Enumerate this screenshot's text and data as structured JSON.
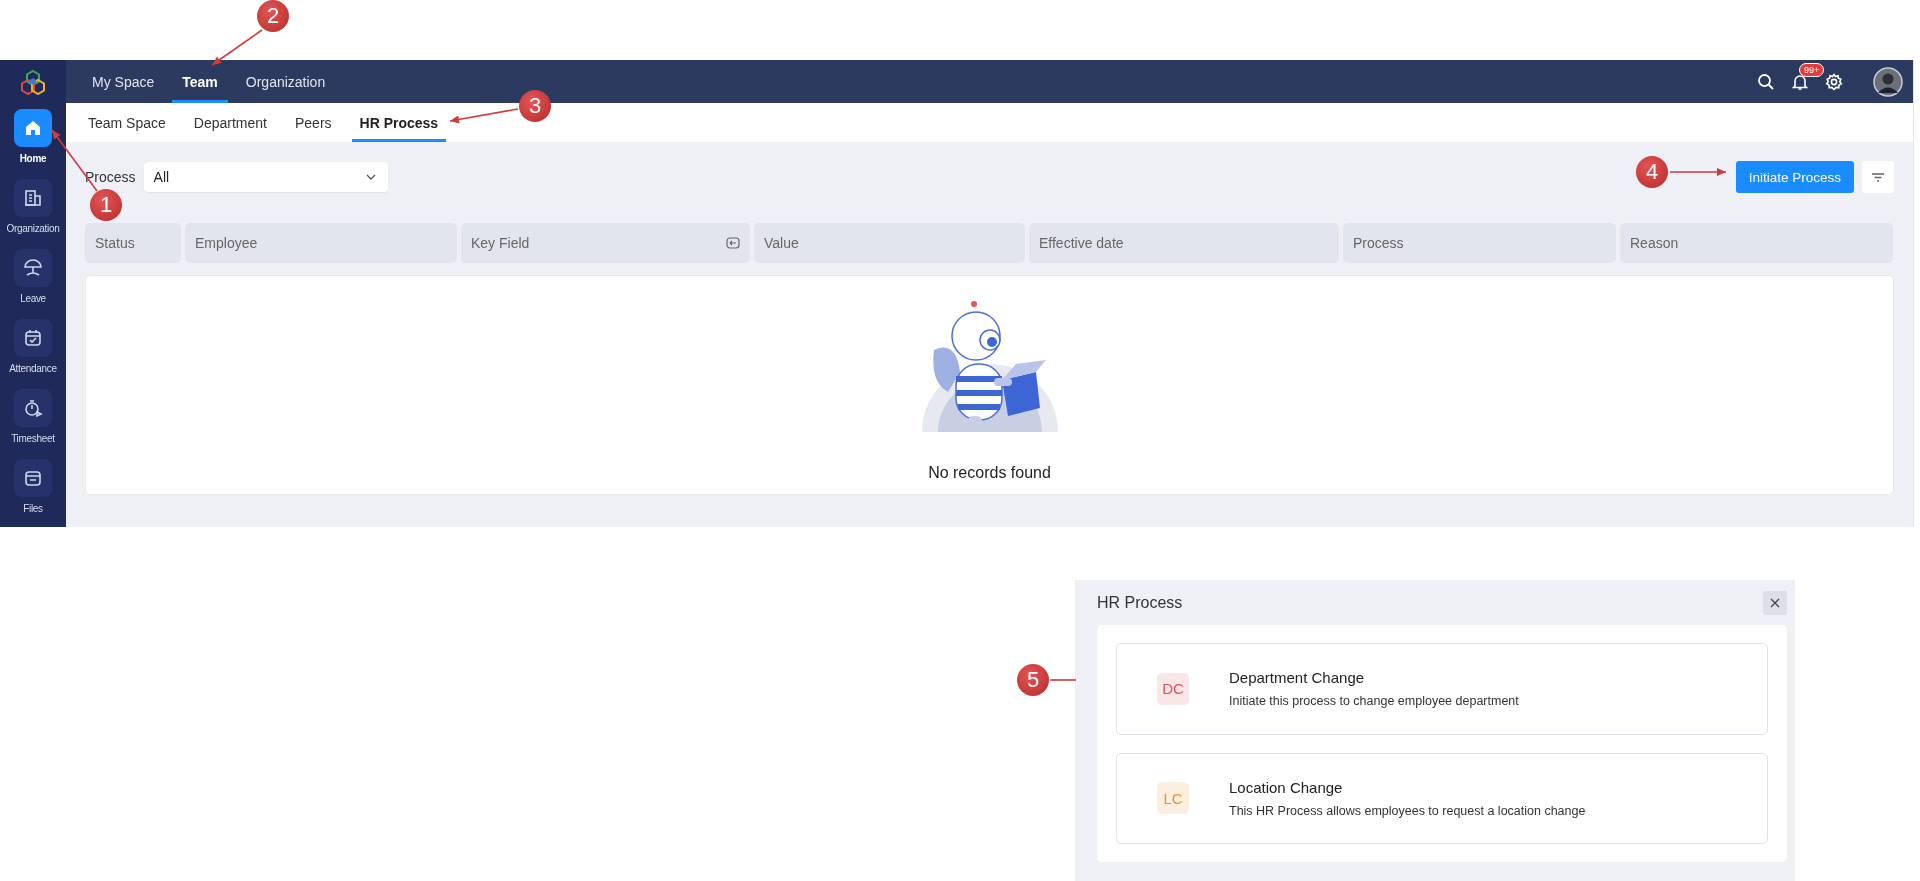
{
  "sidebar": {
    "items": [
      {
        "label": "Home",
        "selected": true
      },
      {
        "label": "Organization",
        "selected": false
      },
      {
        "label": "Leave",
        "selected": false
      },
      {
        "label": "Attendance",
        "selected": false
      },
      {
        "label": "Timesheet",
        "selected": false
      },
      {
        "label": "Files",
        "selected": false
      }
    ]
  },
  "top_nav": {
    "tabs": [
      {
        "label": "My Space",
        "selected": false
      },
      {
        "label": "Team",
        "selected": true
      },
      {
        "label": "Organization",
        "selected": false
      }
    ],
    "notification_badge": "99+"
  },
  "sub_tabs": [
    {
      "label": "Team Space",
      "selected": false
    },
    {
      "label": "Department",
      "selected": false
    },
    {
      "label": "Peers",
      "selected": false
    },
    {
      "label": "HR Process",
      "selected": true
    }
  ],
  "filter": {
    "label": "Process",
    "value": "All"
  },
  "actions": {
    "initiate_button": "Initiate Process"
  },
  "table": {
    "columns": [
      "Status",
      "Employee",
      "Key Field",
      "Value",
      "Effective date",
      "Process",
      "Reason"
    ],
    "empty_message": "No records found"
  },
  "modal": {
    "title": "HR Process",
    "processes": [
      {
        "initials": "DC",
        "title": "Department Change",
        "description": "Initiate this process to change employee department",
        "color": "#e0525b"
      },
      {
        "initials": "LC",
        "title": "Location Change",
        "description": "This HR Process allows employees to request a location change",
        "color": "#e8952a"
      }
    ]
  },
  "annotations": [
    {
      "label": "1"
    },
    {
      "label": "2"
    },
    {
      "label": "3"
    },
    {
      "label": "4"
    },
    {
      "label": "5"
    }
  ]
}
